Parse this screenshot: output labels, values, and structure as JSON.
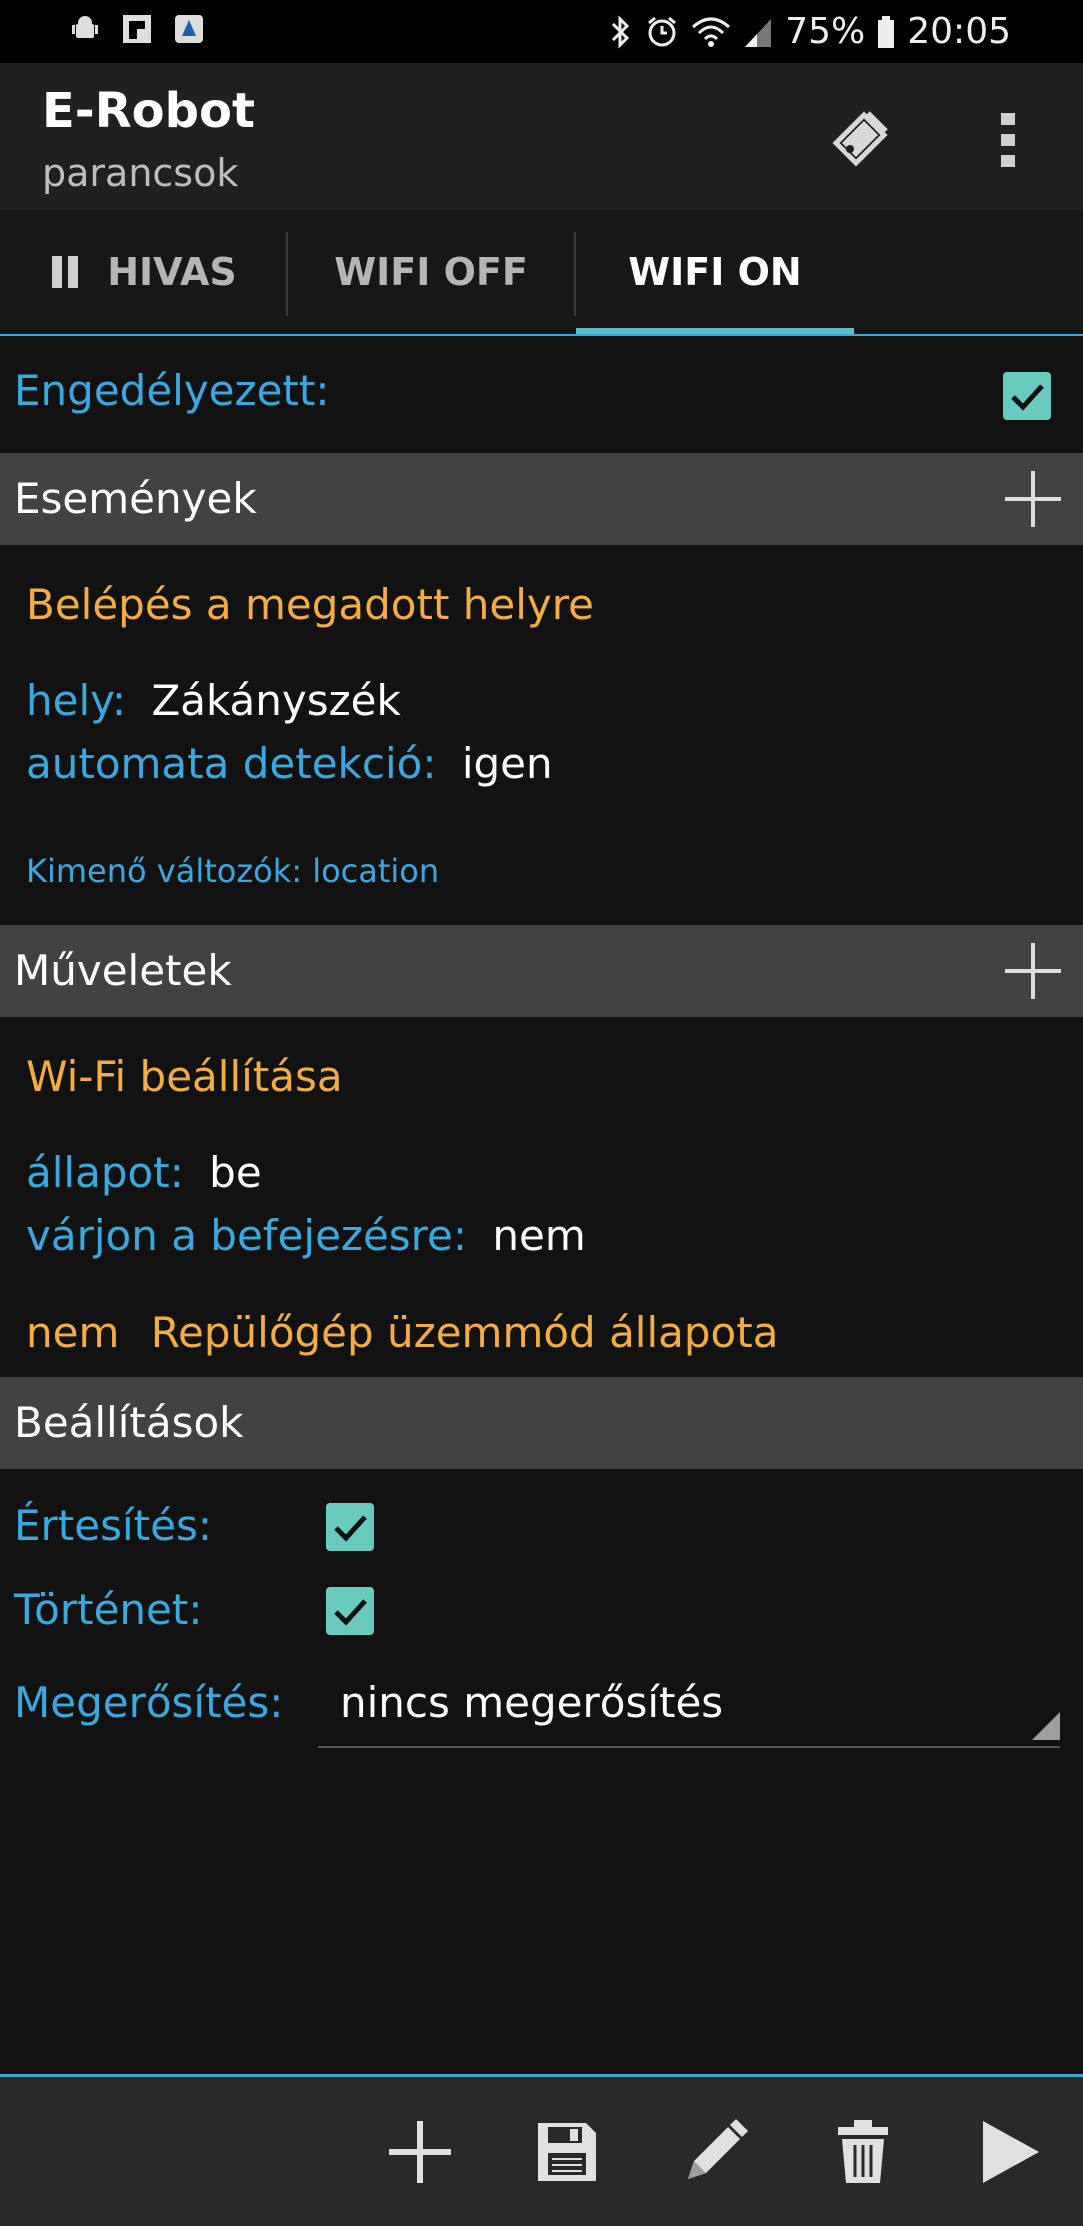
{
  "status_bar": {
    "battery": "75%",
    "time": "20:05",
    "left_icons": [
      "android-icon",
      "flipboard-icon",
      "app-icon"
    ],
    "right_icons": [
      "bluetooth-icon",
      "alarm-icon",
      "wifi-icon",
      "signal-icon",
      "battery-icon"
    ]
  },
  "app_bar": {
    "title": "E-Robot",
    "subtitle": "parancsok",
    "actions": [
      "edit-tag-icon",
      "overflow-menu-icon"
    ]
  },
  "tabs": [
    {
      "label": "HIVAS",
      "icon": "pause-icon"
    },
    {
      "label": "WIFI OFF"
    },
    {
      "label": "WIFI ON",
      "active": true
    }
  ],
  "enabled": {
    "label": "Engedélyezett:",
    "checked": true
  },
  "events": {
    "header": "Események",
    "title": "Belépés a megadott helyre",
    "params": [
      {
        "label": "hely:",
        "value": "Zákányszék"
      },
      {
        "label": "automata detekció:",
        "value": "igen"
      }
    ],
    "output_vars": "Kimenő változók: location"
  },
  "actions": {
    "header": "Műveletek",
    "title": "Wi-Fi beállítása",
    "params": [
      {
        "label": "állapot:",
        "value": "be"
      },
      {
        "label": "várjon a befejezésre:",
        "value": "nem"
      }
    ],
    "condition_neg": "nem",
    "condition": "Repülőgép üzemmód állapota"
  },
  "settings": {
    "header": "Beállítások",
    "notify_label": "Értesítés:",
    "notify_checked": true,
    "history_label": "Történet:",
    "history_checked": true,
    "confirm_label": "Megerősítés:",
    "confirm_value": "nincs megerősítés"
  },
  "bottom_bar": [
    "add-icon",
    "save-icon",
    "edit-icon",
    "delete-icon",
    "play-icon"
  ],
  "colors": {
    "accent_blue": "#39a9e0",
    "accent_orange": "#f3ad45",
    "checkbox_teal": "#69cabf",
    "tab_indicator": "#5bc0c9"
  }
}
